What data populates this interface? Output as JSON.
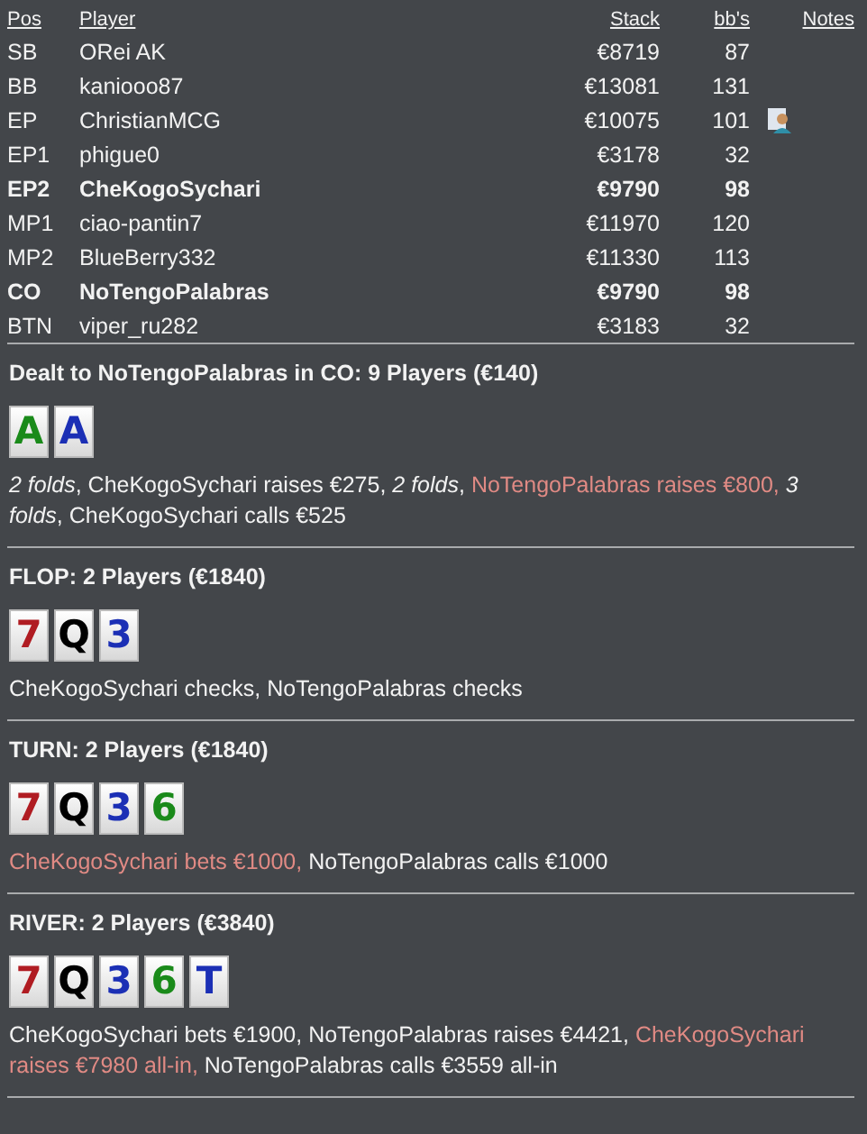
{
  "table": {
    "columns": [
      "Pos",
      "Player",
      "Stack",
      "bb's",
      "Notes"
    ],
    "rows": [
      {
        "pos": "SB",
        "player": "ORei AK",
        "stack": "€8719",
        "bbs": "87",
        "bold": false,
        "note": false
      },
      {
        "pos": "BB",
        "player": "kaniooo87",
        "stack": "€13081",
        "bbs": "131",
        "bold": false,
        "note": false
      },
      {
        "pos": "EP",
        "player": "ChristianMCG",
        "stack": "€10075",
        "bbs": "101",
        "bold": false,
        "note": true
      },
      {
        "pos": "EP1",
        "player": "phigue0",
        "stack": "€3178",
        "bbs": "32",
        "bold": false,
        "note": false
      },
      {
        "pos": "EP2",
        "player": "CheKogoSychari",
        "stack": "€9790",
        "bbs": "98",
        "bold": true,
        "note": false
      },
      {
        "pos": "MP1",
        "player": "ciao-pantin7",
        "stack": "€11970",
        "bbs": "120",
        "bold": false,
        "note": false
      },
      {
        "pos": "MP2",
        "player": "BlueBerry332",
        "stack": "€11330",
        "bbs": "113",
        "bold": false,
        "note": false
      },
      {
        "pos": "CO",
        "player": "NoTengoPalabras",
        "stack": "€9790",
        "bbs": "98",
        "bold": true,
        "note": false
      },
      {
        "pos": "BTN",
        "player": "viper_ru282",
        "stack": "€3183",
        "bbs": "32",
        "bold": false,
        "note": false
      }
    ]
  },
  "streets": [
    {
      "title": "Dealt to NoTengoPalabras in CO: 9 Players (€140)",
      "cards": [
        {
          "rank": "A",
          "color": "#1a8a1a"
        },
        {
          "rank": "A",
          "color": "#1b2fb5"
        }
      ],
      "actions": [
        {
          "kind": "fold",
          "text": "2 folds"
        },
        {
          "kind": "plain",
          "text": ", CheKogoSychari raises €275, "
        },
        {
          "kind": "fold",
          "text": "2 folds"
        },
        {
          "kind": "plain",
          "text": ", "
        },
        {
          "kind": "hero",
          "text": "NoTengoPalabras raises €800, "
        },
        {
          "kind": "fold",
          "text": "3 folds"
        },
        {
          "kind": "plain",
          "text": ", CheKogoSychari calls €525"
        }
      ]
    },
    {
      "title": "FLOP: 2 Players (€1840)",
      "cards": [
        {
          "rank": "7",
          "color": "#b01c22"
        },
        {
          "rank": "Q",
          "color": "#000000"
        },
        {
          "rank": "3",
          "color": "#1b2fb5"
        }
      ],
      "actions": [
        {
          "kind": "plain",
          "text": "CheKogoSychari checks, NoTengoPalabras checks"
        }
      ]
    },
    {
      "title": "TURN: 2 Players (€1840)",
      "cards": [
        {
          "rank": "7",
          "color": "#b01c22"
        },
        {
          "rank": "Q",
          "color": "#000000"
        },
        {
          "rank": "3",
          "color": "#1b2fb5"
        },
        {
          "rank": "6",
          "color": "#1a8a1a"
        }
      ],
      "actions": [
        {
          "kind": "hero",
          "text": "CheKogoSychari bets €1000,"
        },
        {
          "kind": "plain",
          "text": " NoTengoPalabras calls €1000"
        }
      ]
    },
    {
      "title": "RIVER: 2 Players (€3840)",
      "cards": [
        {
          "rank": "7",
          "color": "#b01c22"
        },
        {
          "rank": "Q",
          "color": "#000000"
        },
        {
          "rank": "3",
          "color": "#1b2fb5"
        },
        {
          "rank": "6",
          "color": "#1a8a1a"
        },
        {
          "rank": "T",
          "color": "#1b2fb5"
        }
      ],
      "actions": [
        {
          "kind": "plain",
          "text": "CheKogoSychari bets €1900, NoTengoPalabras raises €4421, "
        },
        {
          "kind": "hero",
          "text": "CheKogoSychari raises €7980 all-in,"
        },
        {
          "kind": "plain",
          "text": " NoTengoPalabras calls €3559 all-in"
        }
      ]
    }
  ]
}
